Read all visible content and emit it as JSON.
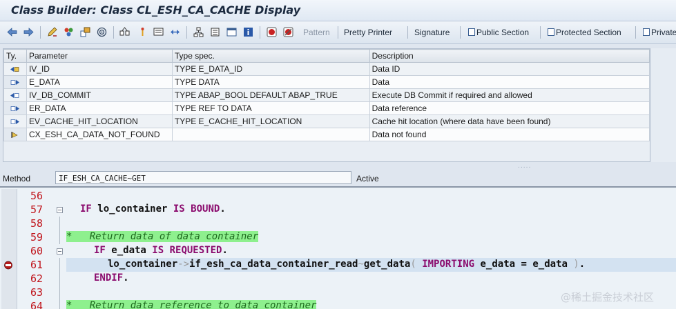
{
  "window": {
    "title": "Class Builder: Class CL_ESH_CA_CACHE Display"
  },
  "toolbar": {
    "icons": [
      "back-arrow-icon",
      "forward-arrow-icon",
      "edit-pencil-icon",
      "activate-icon",
      "object-list-icon",
      "where-used-icon",
      "display-object-list-icon",
      "enhance-icon",
      "breakpoint-icon",
      "navigation-icon",
      "hierarchy-icon",
      "inactive-objects-icon",
      "window-icon",
      "info-icon",
      "stop-icon",
      "breakpoint-set-icon"
    ],
    "pattern": "Pattern",
    "pretty_printer": "Pretty Printer",
    "signature": "Signature",
    "public_section": "Public Section",
    "protected_section": "Protected Section",
    "private_section": "Private"
  },
  "params": {
    "headers": [
      "Ty.",
      "Parameter",
      "Type spec.",
      "Description"
    ],
    "rows": [
      {
        "ty": "importing-icon",
        "param": "IV_ID",
        "type": "TYPE E_DATA_ID",
        "desc": "Data ID"
      },
      {
        "ty": "exporting-icon",
        "param": "E_DATA",
        "type": "TYPE DATA",
        "desc": "Data"
      },
      {
        "ty": "importing-icon",
        "param": "IV_DB_COMMIT",
        "type": "TYPE ABAP_BOOL  DEFAULT ABAP_TRUE",
        "desc": "Execute DB Commit if required and allowed"
      },
      {
        "ty": "exporting-icon",
        "param": "ER_DATA",
        "type": "TYPE REF TO DATA",
        "desc": "Data reference"
      },
      {
        "ty": "exporting-icon",
        "param": "EV_CACHE_HIT_LOCATION",
        "type": "TYPE E_CACHE_HIT_LOCATION",
        "desc": "Cache hit location (where data have been found)"
      },
      {
        "ty": "exception-icon",
        "param": "CX_ESH_CA_DATA_NOT_FOUND",
        "type": "",
        "desc": "Data not found"
      }
    ]
  },
  "method": {
    "label": "Method",
    "value": "IF_ESH_CA_CACHE~GET",
    "status": "Active"
  },
  "editor": {
    "line_numbers": [
      "56",
      "57",
      "58",
      "59",
      "60",
      "61",
      "62",
      "63",
      "64"
    ],
    "l57": {
      "kw1": "IF",
      "t1": " lo_container ",
      "kw2": "IS BOUND",
      "t2": "."
    },
    "l59": "*   Return data of data container",
    "l60": {
      "kw1": "IF",
      "t1": " e_data ",
      "kw2": "IS REQUESTED",
      "t2": "."
    },
    "l61": {
      "t1": "lo_container",
      "op1": "->",
      "t2": "if_esh_ca_data_container_read",
      "op2": "~",
      "t3": "get_data",
      "op3": "(",
      "t4": " ",
      "kw1": "IMPORTING",
      "t5": " e_data = e_data ",
      "op4": ")",
      "t6": "."
    },
    "l62": {
      "kw1": "ENDIF",
      "t1": "."
    },
    "l64": "*   Return data reference to data container"
  },
  "watermark": "@稀土掘金技术社区"
}
